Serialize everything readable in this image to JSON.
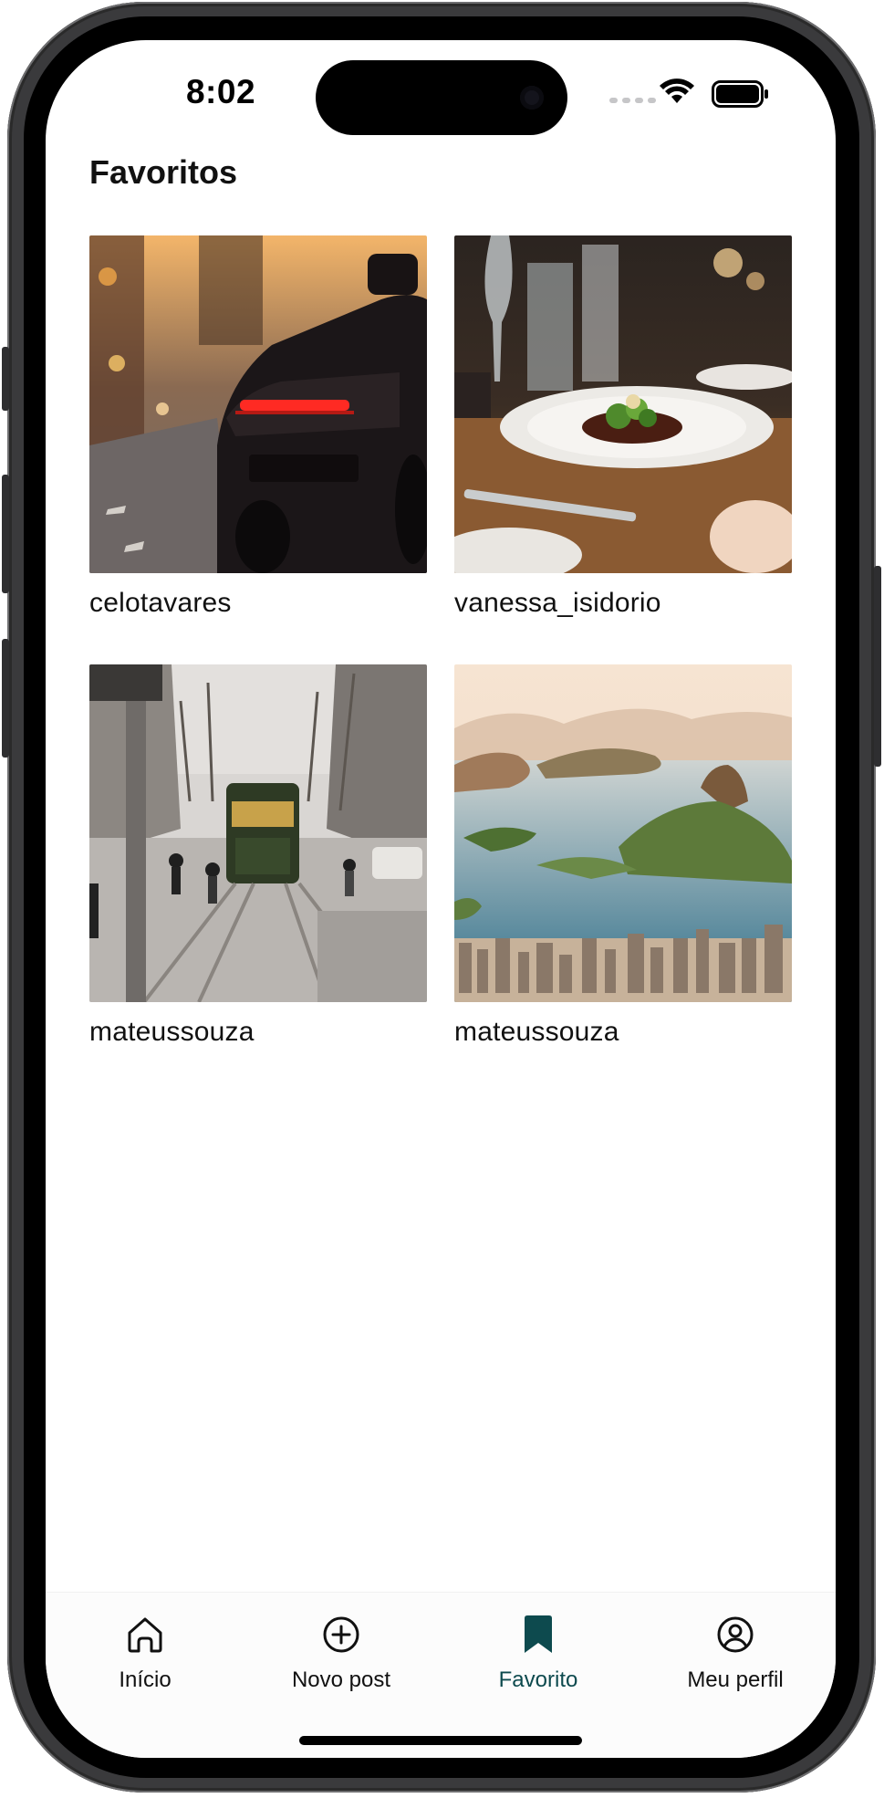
{
  "status_bar": {
    "time": "8:02"
  },
  "header": {
    "title": "Favoritos"
  },
  "favorites": [
    {
      "username": "celotavares",
      "image": "car-rear-night-street"
    },
    {
      "username": "vanessa_isidorio",
      "image": "restaurant-plated-dish"
    },
    {
      "username": "mateussouza",
      "image": "city-tram-street"
    },
    {
      "username": "mateussouza",
      "image": "coastal-city-aerial"
    }
  ],
  "tabbar": {
    "items": [
      {
        "label": "Início",
        "icon": "home-icon"
      },
      {
        "label": "Novo post",
        "icon": "plus-circle-icon"
      },
      {
        "label": "Favorito",
        "icon": "bookmark-icon",
        "active": true
      },
      {
        "label": "Meu perfil",
        "icon": "user-circle-icon"
      }
    ]
  },
  "colors": {
    "accent": "#0d4a4e",
    "text": "#111111",
    "background": "#ffffff"
  }
}
